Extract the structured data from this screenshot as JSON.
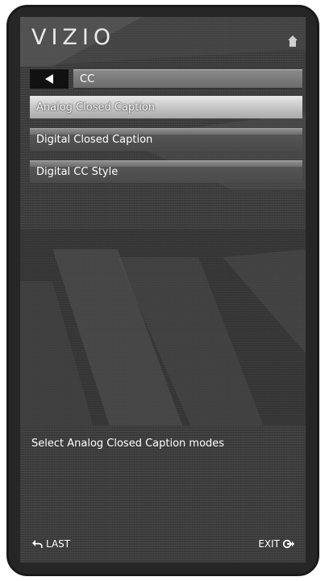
{
  "header": {
    "logo": "VIZIO",
    "home_icon": "home-icon"
  },
  "nav": {
    "back_icon": "back-arrow-icon",
    "breadcrumb": "CC"
  },
  "menu": {
    "items": [
      {
        "label": "Analog Closed Caption",
        "state": "selected"
      },
      {
        "label": "Digital Closed Caption",
        "state": "normal"
      },
      {
        "label": "Digital CC Style",
        "state": "normal"
      }
    ]
  },
  "description": "Select Analog Closed Caption modes",
  "footer": {
    "last_label": "LAST",
    "last_icon": "return-arrow-icon",
    "exit_label": "EXIT",
    "exit_icon": "exit-icon"
  }
}
